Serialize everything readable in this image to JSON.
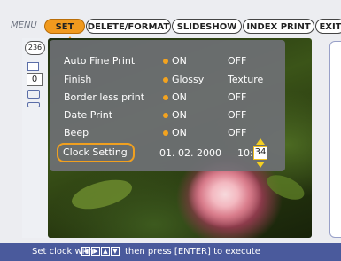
{
  "menu": {
    "label": "MENU",
    "tabs": [
      {
        "label": "SET",
        "active": true
      },
      {
        "label": "DELETE/FORMAT",
        "active": false
      },
      {
        "label": "SLIDESHOW",
        "active": false
      },
      {
        "label": "INDEX PRINT",
        "active": false
      },
      {
        "label": "EXIT",
        "active": false
      }
    ]
  },
  "status": {
    "image_count": "236",
    "copies": "0"
  },
  "settings": [
    {
      "label": "Auto Fine Print",
      "option1": "ON",
      "option2": "OFF",
      "selected": 1
    },
    {
      "label": "Finish",
      "option1": "Glossy",
      "option2": "Texture",
      "selected": 1
    },
    {
      "label": "Border less print",
      "option1": "ON",
      "option2": "OFF",
      "selected": 1
    },
    {
      "label": "Date Print",
      "option1": "ON",
      "option2": "OFF",
      "selected": 1
    },
    {
      "label": "Beep",
      "option1": "ON",
      "option2": "OFF",
      "selected": 1
    }
  ],
  "clock": {
    "label": "Clock Setting",
    "date": "01. 02. 2000",
    "hour": "10:",
    "minute": "34"
  },
  "footer": {
    "prefix": "Set clock with",
    "keys": [
      "◀",
      "▶",
      "▲",
      "▼"
    ],
    "suffix": "then press [ENTER] to execute"
  },
  "colors": {
    "accent": "#f19a1e",
    "bottom_bar": "#4a5a9c",
    "panel": "#6e7074"
  }
}
